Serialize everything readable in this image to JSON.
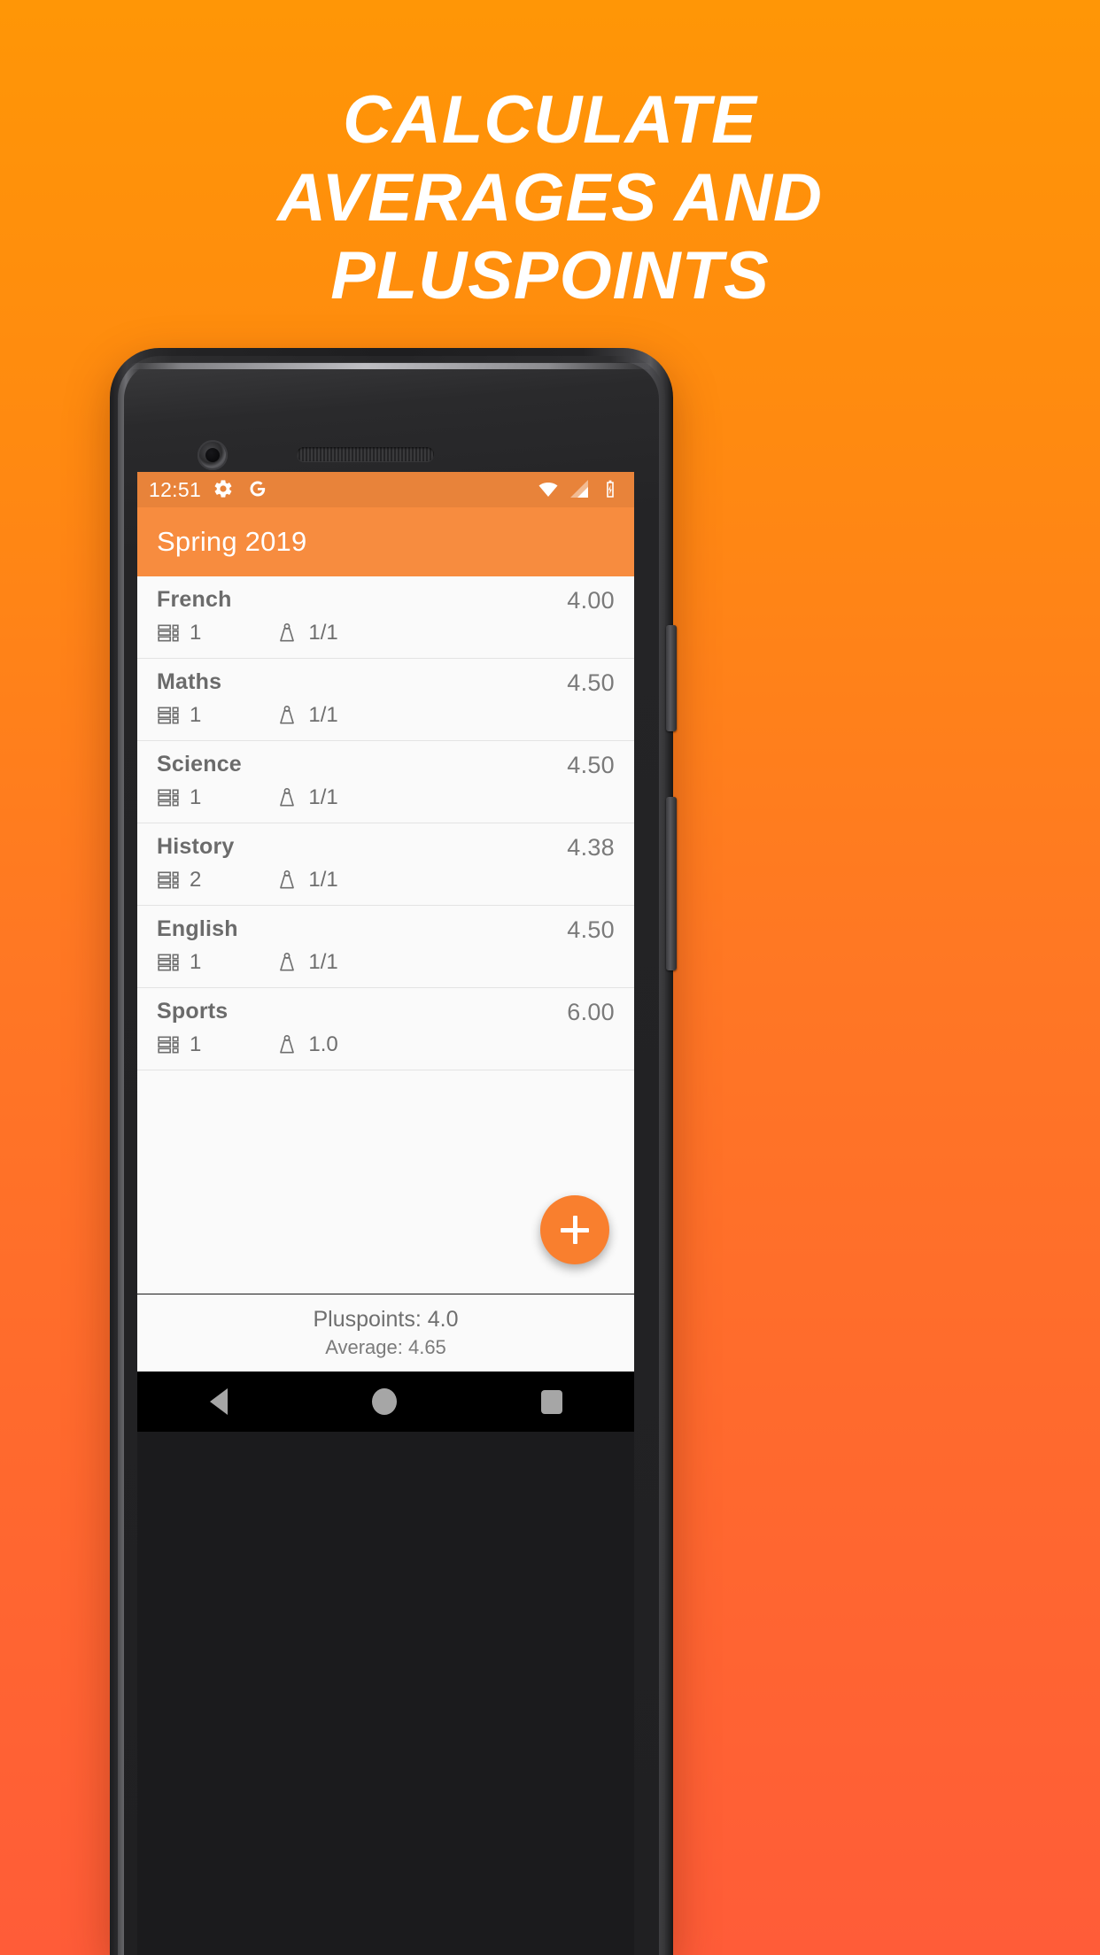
{
  "headline": {
    "lines": [
      "CALCULATE",
      "AVERAGES AND",
      "PLUSPOINTS"
    ]
  },
  "colors": {
    "bg_top": "#FF9606",
    "bg_bottom": "#FF5C38",
    "appbar": "#F78C3F",
    "statusbar": "#E8833A",
    "fab": "#F97F2E",
    "screen_bg": "#FAFAFA"
  },
  "phone": {
    "status_bar": {
      "clock": "12:51",
      "left_icons": [
        "gear-icon",
        "google-g-icon"
      ],
      "right_icons": [
        "wifi-icon",
        "signal-icon",
        "battery-charging-icon"
      ]
    },
    "app_bar": {
      "title": "Spring 2019"
    },
    "list": {
      "grade_count_icon": "grades-list-icon",
      "weight_icon": "weight-icon",
      "rows": [
        {
          "subject": "French",
          "grade": "4.00",
          "count": "1",
          "weight": "1/1"
        },
        {
          "subject": "Maths",
          "grade": "4.50",
          "count": "1",
          "weight": "1/1"
        },
        {
          "subject": "Science",
          "grade": "4.50",
          "count": "1",
          "weight": "1/1"
        },
        {
          "subject": "History",
          "grade": "4.38",
          "count": "2",
          "weight": "1/1"
        },
        {
          "subject": "English",
          "grade": "4.50",
          "count": "1",
          "weight": "1/1"
        },
        {
          "subject": "Sports",
          "grade": "6.00",
          "count": "1",
          "weight": "1.0"
        }
      ]
    },
    "fab": {
      "label": "+",
      "name": "add-subject-button"
    },
    "summary": {
      "pluspoints": "Pluspoints: 4.0",
      "average": "Average: 4.65"
    },
    "nav_bar": {
      "back": "back-button",
      "home": "home-button",
      "recents": "recents-button"
    }
  }
}
